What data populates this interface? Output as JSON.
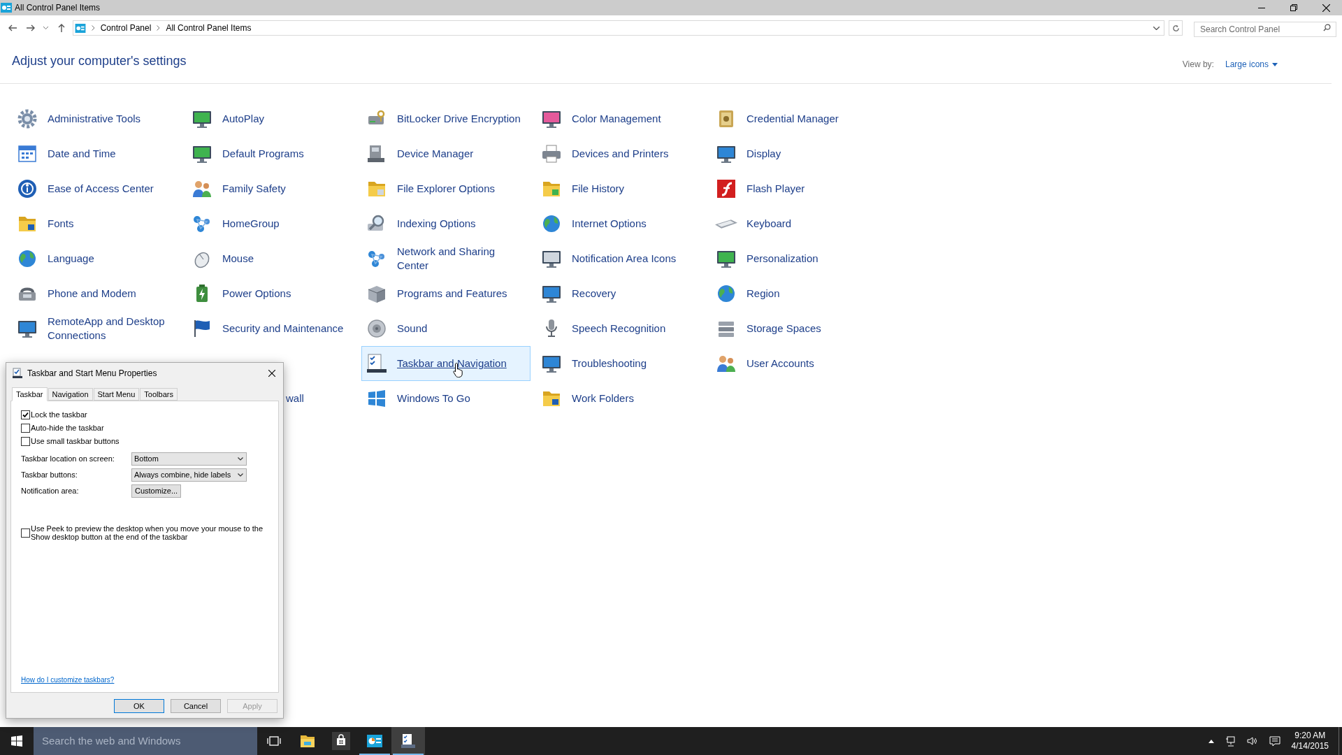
{
  "window": {
    "title": "All Control Panel Items"
  },
  "address_bar": {
    "breadcrumbs": [
      "Control Panel",
      "All Control Panel Items"
    ]
  },
  "search": {
    "placeholder": "Search Control Panel"
  },
  "heading": "Adjust your computer's settings",
  "view_by": {
    "label": "View by:",
    "value": "Large icons"
  },
  "rows": [
    [
      {
        "label": "Administrative Tools",
        "selected": false
      },
      {
        "label": "AutoPlay",
        "selected": false
      },
      {
        "label": "BitLocker Drive Encryption",
        "selected": false
      },
      {
        "label": "Color Management",
        "selected": false
      },
      {
        "label": "Credential Manager",
        "selected": false
      }
    ],
    [
      {
        "label": "Date and Time",
        "selected": false
      },
      {
        "label": "Default Programs",
        "selected": false
      },
      {
        "label": "Device Manager",
        "selected": false
      },
      {
        "label": "Devices and Printers",
        "selected": false
      },
      {
        "label": "Display",
        "selected": false
      }
    ],
    [
      {
        "label": "Ease of Access Center",
        "selected": false
      },
      {
        "label": "Family Safety",
        "selected": false
      },
      {
        "label": "File Explorer Options",
        "selected": false
      },
      {
        "label": "File History",
        "selected": false
      },
      {
        "label": "Flash Player",
        "selected": false
      }
    ],
    [
      {
        "label": "Fonts",
        "selected": false
      },
      {
        "label": "HomeGroup",
        "selected": false
      },
      {
        "label": "Indexing Options",
        "selected": false
      },
      {
        "label": "Internet Options",
        "selected": false
      },
      {
        "label": "Keyboard",
        "selected": false
      }
    ],
    [
      {
        "label": "Language",
        "selected": false
      },
      {
        "label": "Mouse",
        "selected": false
      },
      {
        "label": "Network and Sharing Center",
        "selected": false
      },
      {
        "label": "Notification Area Icons",
        "selected": false
      },
      {
        "label": "Personalization",
        "selected": false
      }
    ],
    [
      {
        "label": "Phone and Modem",
        "selected": false
      },
      {
        "label": "Power Options",
        "selected": false
      },
      {
        "label": "Programs and Features",
        "selected": false
      },
      {
        "label": "Recovery",
        "selected": false
      },
      {
        "label": "Region",
        "selected": false
      }
    ],
    [
      {
        "label": "RemoteApp and Desktop Connections",
        "selected": false
      },
      {
        "label": "Security and Maintenance",
        "selected": false
      },
      {
        "label": "Sound",
        "selected": false
      },
      {
        "label": "Speech Recognition",
        "selected": false
      },
      {
        "label": "Storage Spaces",
        "selected": false
      }
    ],
    [
      {
        "label": "Taskbar and Navigation",
        "selected": true
      },
      {
        "label": "Troubleshooting",
        "selected": false
      },
      {
        "label": "User Accounts",
        "selected": false
      }
    ],
    [
      {
        "label": "wall",
        "selected": false,
        "kind": "partial"
      },
      {
        "label": "Windows To Go",
        "selected": false
      },
      {
        "label": "Work Folders",
        "selected": false
      }
    ]
  ],
  "dialog": {
    "title": "Taskbar and Start Menu Properties",
    "tabs": [
      {
        "label": "Taskbar",
        "selected": true
      },
      {
        "label": "Navigation",
        "selected": false
      },
      {
        "label": "Start Menu",
        "selected": false
      },
      {
        "label": "Toolbars",
        "selected": false
      }
    ],
    "options": [
      {
        "label": "Lock the taskbar",
        "checked": true
      },
      {
        "label": "Auto-hide the taskbar",
        "checked": false
      },
      {
        "label": "Use small taskbar buttons",
        "checked": false
      }
    ],
    "fields": [
      {
        "label": "Taskbar location on screen:",
        "value": "Bottom",
        "kind": "select"
      },
      {
        "label": "Taskbar buttons:",
        "value": "Always combine, hide labels",
        "kind": "select"
      },
      {
        "label": "Notification area:",
        "value": "Customize...",
        "kind": "button"
      }
    ],
    "peek": {
      "label": "Use Peek to preview the desktop when you move your mouse to the Show desktop button at the end of the taskbar",
      "checked": false
    },
    "help_link": "How do I customize taskbars?",
    "buttons": [
      {
        "label": "OK",
        "kind": "default",
        "disabled": false
      },
      {
        "label": "Cancel",
        "kind": "normal",
        "disabled": false
      },
      {
        "label": "Apply",
        "kind": "normal",
        "disabled": true
      }
    ]
  },
  "taskbar": {
    "search_placeholder": "Search the web and Windows",
    "apps": [
      {
        "kind": "explorer",
        "running": false,
        "selected": false
      },
      {
        "kind": "store",
        "running": false,
        "selected": false
      },
      {
        "kind": "control",
        "running": true,
        "selected": false
      },
      {
        "kind": "taskbar",
        "running": true,
        "selected": true
      }
    ],
    "clock": {
      "time": "9:20 AM",
      "date": "4/14/2015"
    }
  }
}
